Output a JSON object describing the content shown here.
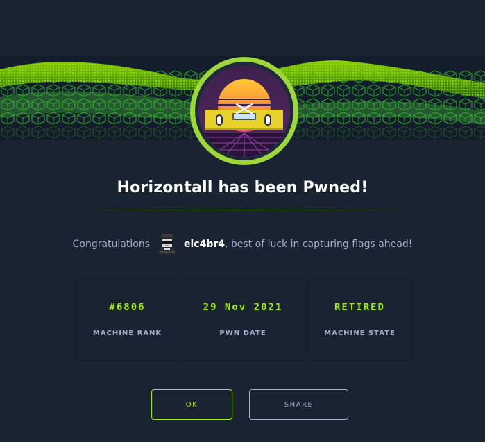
{
  "modal": {
    "title": "Horizontall has been Pwned!"
  },
  "congrats": {
    "prefix": "Congratulations",
    "username": "elc4br4",
    "suffix": ", best of luck in capturing flags ahead!"
  },
  "stats": [
    {
      "value": "#6806",
      "label": "MACHINE RANK"
    },
    {
      "value": "29 Nov 2021",
      "label": "PWN DATE"
    },
    {
      "value": "RETIRED",
      "label": "MACHINE STATE"
    }
  ],
  "buttons": {
    "ok_label": "OK",
    "share_label": "SHARE"
  },
  "colors": {
    "background": "#1a2332",
    "accent": "#9fef00",
    "text_muted": "#a4b1cd",
    "border": "#141d2b"
  },
  "icons": {
    "banner": "green-cube-wave",
    "badge": "synthwave-sun-machine-badge",
    "avatar": "hacker-avatar-icon"
  }
}
